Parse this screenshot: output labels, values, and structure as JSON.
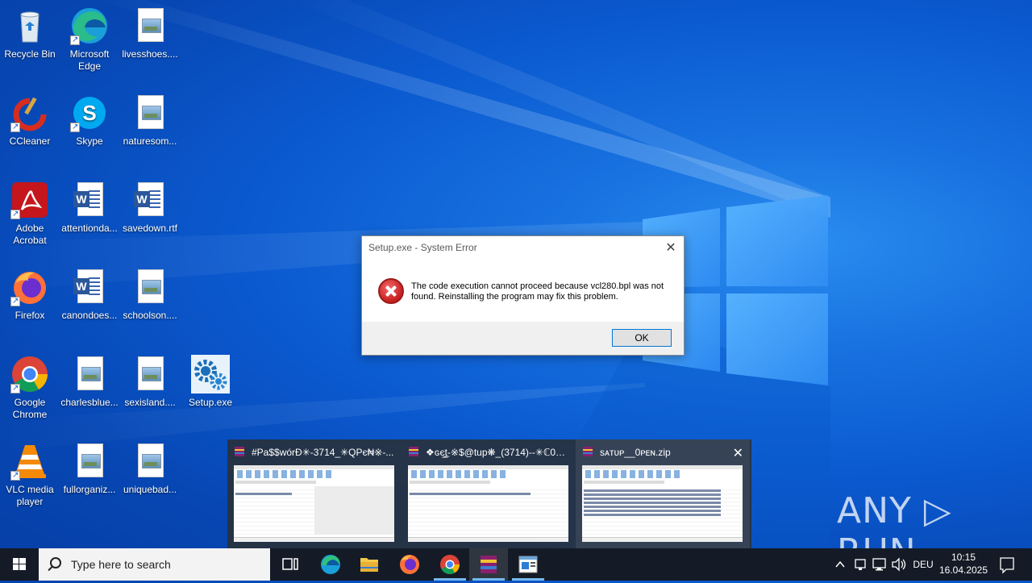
{
  "desktop": {
    "icons": [
      {
        "label": "Recycle Bin"
      },
      {
        "label": "Microsoft Edge"
      },
      {
        "label": "livesshoes...."
      },
      {
        "label": "CCleaner"
      },
      {
        "label": "Skype"
      },
      {
        "label": "naturesom..."
      },
      {
        "label": "Adobe Acrobat"
      },
      {
        "label": "attentionda..."
      },
      {
        "label": "savedown.rtf"
      },
      {
        "label": "Firefox"
      },
      {
        "label": "canondoes..."
      },
      {
        "label": "schoolson...."
      },
      {
        "label": "Google Chrome"
      },
      {
        "label": "charlesblue..."
      },
      {
        "label": "sexisland...."
      },
      {
        "label": "Setup.exe"
      },
      {
        "label": "VLC media player"
      },
      {
        "label": "fullorganiz..."
      },
      {
        "label": "uniquebad..."
      }
    ]
  },
  "dialog": {
    "title": "Setup.exe - System Error",
    "message": "The code execution cannot proceed because vcl280.bpl was not found. Reinstalling the program may fix this problem.",
    "ok_label": "OK",
    "close_glyph": "✕"
  },
  "preview": {
    "windows": [
      {
        "title": "#Pa$$wórÐ✳-3714_✳QPє₦※-..."
      },
      {
        "title": "❖ɢє̲t̲-※$@tup❋_(3714)--✳ℂ0Ɗ..."
      },
      {
        "title": "sᴀᴛᴜᴘ__0ᴘᴇɴ.zip"
      }
    ],
    "close_glyph": "✕"
  },
  "taskbar": {
    "search_placeholder": "Type here to search",
    "language": "DEU",
    "time": "10:15",
    "date": "16.04.2025"
  },
  "watermark": {
    "text": "ANY ▷ RUN"
  },
  "colors": {
    "accent": "#0078d7",
    "taskbar": "#141b26",
    "error_red": "#c81d1d"
  }
}
